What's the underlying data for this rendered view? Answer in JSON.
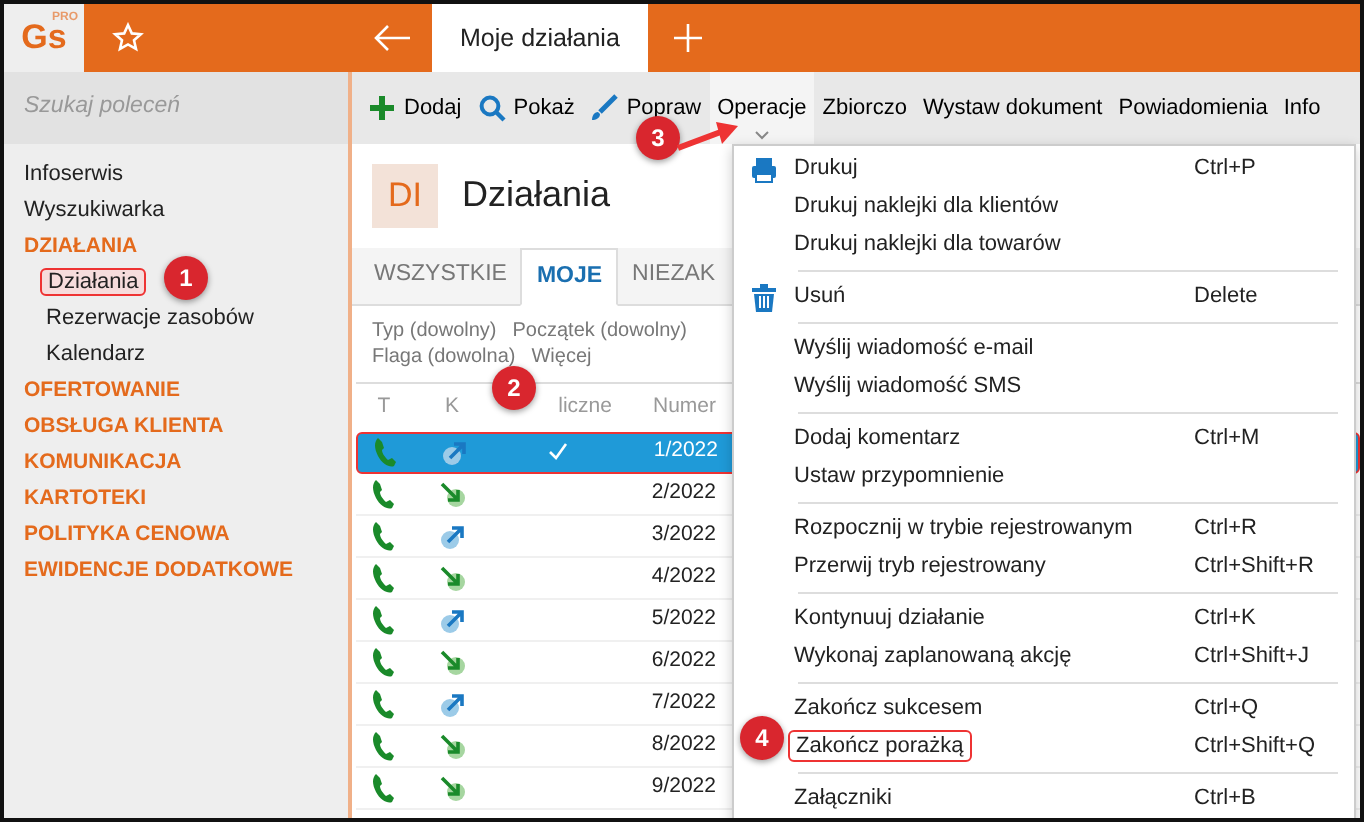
{
  "header": {
    "logo": "Gs",
    "logo_tag": "PRO",
    "tab": "Moje działania"
  },
  "sidebar": {
    "search": {
      "placeholder": "Szukaj poleceń"
    },
    "items": [
      {
        "label": "Infoserwis",
        "kind": "link"
      },
      {
        "label": "Wyszukiwarka",
        "kind": "link"
      },
      {
        "label": "DZIAŁANIA",
        "kind": "section",
        "children": [
          {
            "label": "Działania",
            "selected": true
          },
          {
            "label": "Rezerwacje zasobów",
            "selected": false
          },
          {
            "label": "Kalendarz",
            "selected": false
          }
        ]
      },
      {
        "label": "OFERTOWANIE",
        "kind": "section"
      },
      {
        "label": "OBSŁUGA KLIENTA",
        "kind": "section"
      },
      {
        "label": "KOMUNIKACJA",
        "kind": "section"
      },
      {
        "label": "KARTOTEKI",
        "kind": "section"
      },
      {
        "label": "POLITYKA CENOWA",
        "kind": "section"
      },
      {
        "label": "EWIDENCJE DODATKOWE",
        "kind": "section"
      }
    ]
  },
  "toolbar": [
    {
      "label": "Dodaj",
      "kind": "add",
      "selected": false
    },
    {
      "label": "Pokaż",
      "kind": "search",
      "selected": false
    },
    {
      "label": "Popraw",
      "kind": "edit",
      "selected": false
    },
    {
      "label": "Operacje",
      "kind": "menu",
      "selected": true
    },
    {
      "label": "Zbiorczo",
      "kind": "text",
      "selected": false
    },
    {
      "label": "Wystaw dokument",
      "kind": "text",
      "selected": false
    },
    {
      "label": "Powiadomienia",
      "kind": "text",
      "selected": false
    },
    {
      "label": "Info",
      "kind": "text",
      "selected": false
    }
  ],
  "module": {
    "code": "DI",
    "title": "Działania"
  },
  "tabs": [
    {
      "label": "WSZYSTKIE",
      "selected": false
    },
    {
      "label": "MOJE",
      "selected": true
    },
    {
      "label": "NIEZAK",
      "selected": false
    }
  ],
  "filters": [
    [
      "Typ (dowolny)",
      "Początek (dowolny)"
    ],
    [
      "Flaga (dowolna)",
      "Więcej"
    ]
  ],
  "table": {
    "columns": [
      "T",
      "K",
      "liczne",
      "Numer"
    ],
    "rows": [
      {
        "kind": "out",
        "cyclic": true,
        "number": "1/2022",
        "selected": true
      },
      {
        "kind": "in",
        "cyclic": false,
        "number": "2/2022",
        "selected": false
      },
      {
        "kind": "out",
        "cyclic": false,
        "number": "3/2022",
        "selected": false
      },
      {
        "kind": "in",
        "cyclic": false,
        "number": "4/2022",
        "selected": false
      },
      {
        "kind": "out",
        "cyclic": false,
        "number": "5/2022",
        "selected": false
      },
      {
        "kind": "in",
        "cyclic": false,
        "number": "6/2022",
        "selected": false
      },
      {
        "kind": "out",
        "cyclic": false,
        "number": "7/2022",
        "selected": false
      },
      {
        "kind": "in",
        "cyclic": false,
        "number": "8/2022",
        "selected": false
      },
      {
        "kind": "in",
        "cyclic": false,
        "number": "9/2022",
        "selected": false
      }
    ]
  },
  "menu": [
    [
      {
        "label": "Drukuj",
        "shortcut": "Ctrl+P",
        "kind": "print"
      },
      {
        "label": "Drukuj naklejki dla klientów"
      },
      {
        "label": "Drukuj naklejki dla towarów"
      }
    ],
    [
      {
        "label": "Usuń",
        "shortcut": "Delete",
        "kind": "trash"
      }
    ],
    [
      {
        "label": "Wyślij wiadomość e-mail"
      },
      {
        "label": "Wyślij wiadomość SMS"
      }
    ],
    [
      {
        "label": "Dodaj komentarz",
        "shortcut": "Ctrl+M"
      },
      {
        "label": "Ustaw przypomnienie"
      }
    ],
    [
      {
        "label": "Rozpocznij w trybie rejestrowanym",
        "shortcut": "Ctrl+R"
      },
      {
        "label": "Przerwij tryb rejestrowany",
        "shortcut": "Ctrl+Shift+R"
      }
    ],
    [
      {
        "label": "Kontynuuj działanie",
        "shortcut": "Ctrl+K"
      },
      {
        "label": "Wykonaj zaplanowaną akcję",
        "shortcut": "Ctrl+Shift+J"
      }
    ],
    [
      {
        "label": "Zakończ sukcesem",
        "shortcut": "Ctrl+Q"
      },
      {
        "label": "Zakończ porażką",
        "shortcut": "Ctrl+Shift+Q",
        "highlighted": true
      }
    ],
    [
      {
        "label": "Załączniki",
        "shortcut": "Ctrl+B"
      }
    ]
  ],
  "annotations": [
    "1",
    "2",
    "3",
    "4"
  ]
}
